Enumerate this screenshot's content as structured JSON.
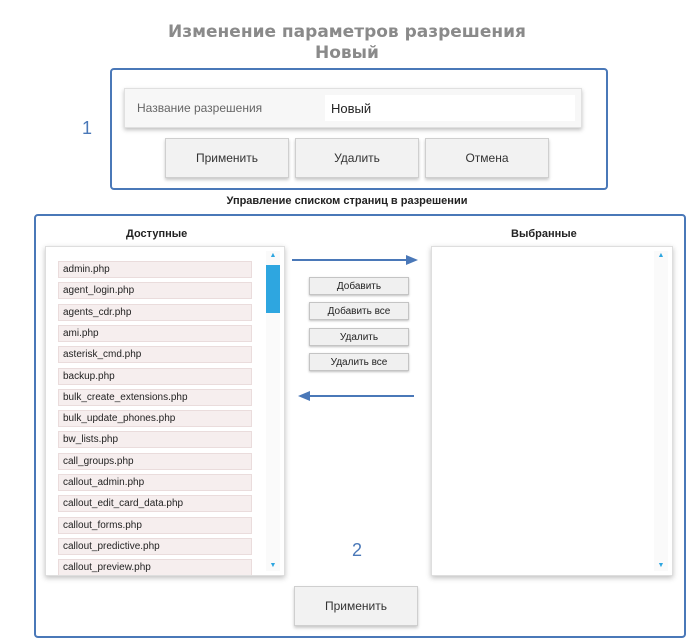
{
  "header": {
    "title_line1": "Изменение параметров разрешения",
    "title_line2": "Новый"
  },
  "markers": {
    "section1": "1",
    "section2": "2"
  },
  "permission": {
    "name_label": "Название разрешения",
    "name_value": "Новый"
  },
  "top_actions": {
    "apply_label": "Применить",
    "delete_label": "Удалить",
    "cancel_label": "Отмена"
  },
  "pages_section": {
    "title": "Управление списком страниц в разрешении",
    "available_header": "Доступные",
    "selected_header": "Выбранные",
    "available_items": [
      "admin.php",
      "agent_login.php",
      "agents_cdr.php",
      "ami.php",
      "asterisk_cmd.php",
      "backup.php",
      "bulk_create_extensions.php",
      "bulk_update_phones.php",
      "bw_lists.php",
      "call_groups.php",
      "callout_admin.php",
      "callout_edit_card_data.php",
      "callout_forms.php",
      "callout_predictive.php",
      "callout_preview.php"
    ],
    "selected_items": [],
    "add_label": "Добавить",
    "add_all_label": "Добавить все",
    "remove_label": "Удалить",
    "remove_all_label": "Удалить все",
    "apply_label": "Применить"
  },
  "colors": {
    "frame_border": "#4a78b8",
    "scroll_accent": "#2ea6e0",
    "list_item_bg": "#f6eeee"
  },
  "scroll": {
    "available_position": 0.0
  }
}
